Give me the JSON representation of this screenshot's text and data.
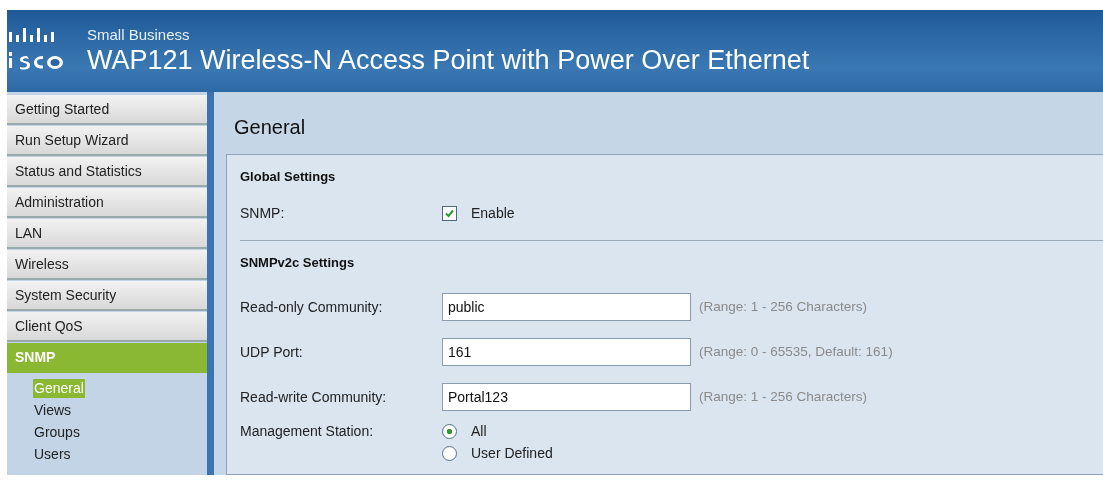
{
  "header": {
    "brand": "Small Business",
    "title": "WAP121 Wireless-N Access Point with Power Over Ethernet"
  },
  "sidebar": {
    "items": [
      {
        "label": "Getting Started",
        "selected": false
      },
      {
        "label": "Run Setup Wizard",
        "selected": false
      },
      {
        "label": "Status and Statistics",
        "selected": false
      },
      {
        "label": "Administration",
        "selected": false
      },
      {
        "label": "LAN",
        "selected": false
      },
      {
        "label": "Wireless",
        "selected": false
      },
      {
        "label": "System Security",
        "selected": false
      },
      {
        "label": "Client QoS",
        "selected": false
      },
      {
        "label": "SNMP",
        "selected": true,
        "children": [
          {
            "label": "General",
            "selected": true
          },
          {
            "label": "Views",
            "selected": false
          },
          {
            "label": "Groups",
            "selected": false
          },
          {
            "label": "Users",
            "selected": false
          }
        ]
      }
    ]
  },
  "page": {
    "title": "General",
    "sections": [
      {
        "heading": "Global Settings",
        "fields": [
          {
            "kind": "checkbox",
            "label": "SNMP:",
            "option": "Enable",
            "checked": true
          }
        ]
      },
      {
        "heading": "SNMPv2c Settings",
        "fields": [
          {
            "kind": "text",
            "label": "Read-only Community:",
            "value": "public",
            "hint": "(Range: 1 - 256 Characters)"
          },
          {
            "kind": "text",
            "label": "UDP Port:",
            "value": "161",
            "hint": "(Range: 0 - 65535, Default: 161)"
          },
          {
            "kind": "text",
            "label": "Read-write Community:",
            "value": "Portal123",
            "hint": "(Range: 1 - 256 Characters)"
          },
          {
            "kind": "radio",
            "label": "Management Station:",
            "options": [
              {
                "label": "All",
                "selected": true
              },
              {
                "label": "User Defined",
                "selected": false
              }
            ]
          }
        ]
      }
    ]
  }
}
